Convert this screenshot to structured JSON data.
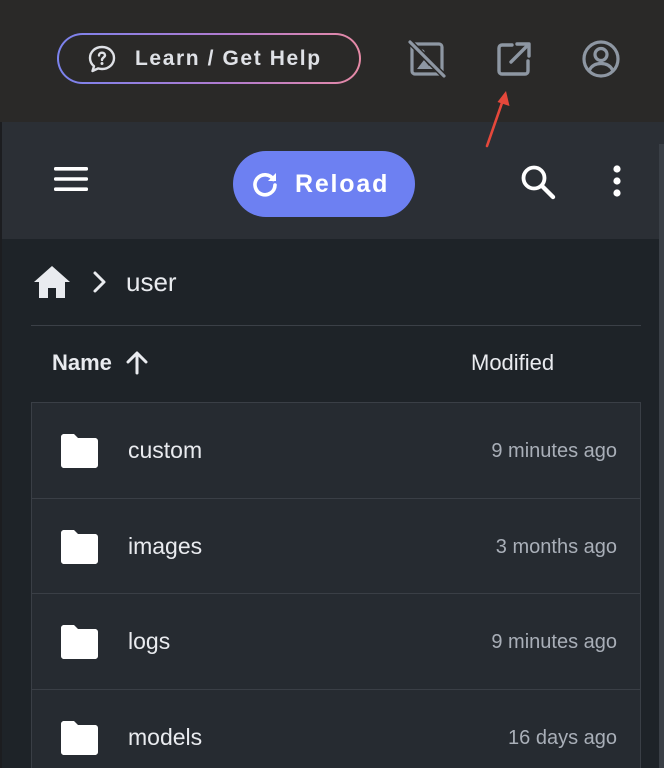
{
  "topbar": {
    "help_label": "Learn / Get Help",
    "icons": [
      "image-off-icon",
      "open-external-icon",
      "account-icon"
    ]
  },
  "toolbar": {
    "reload_label": "Reload"
  },
  "breadcrumb": {
    "current": "user"
  },
  "table": {
    "columns": {
      "name": "Name",
      "modified": "Modified"
    },
    "sort": "ascending",
    "rows": [
      {
        "name": "custom",
        "modified": "9 minutes ago"
      },
      {
        "name": "images",
        "modified": "3 months ago"
      },
      {
        "name": "logs",
        "modified": "9 minutes ago"
      },
      {
        "name": "models",
        "modified": "16 days ago"
      }
    ]
  },
  "colors": {
    "accent": "#6d80f2",
    "annotation_arrow": "#e5483b",
    "topbar_bg": "#2a2928",
    "panel_bg": "#2b2f35"
  }
}
